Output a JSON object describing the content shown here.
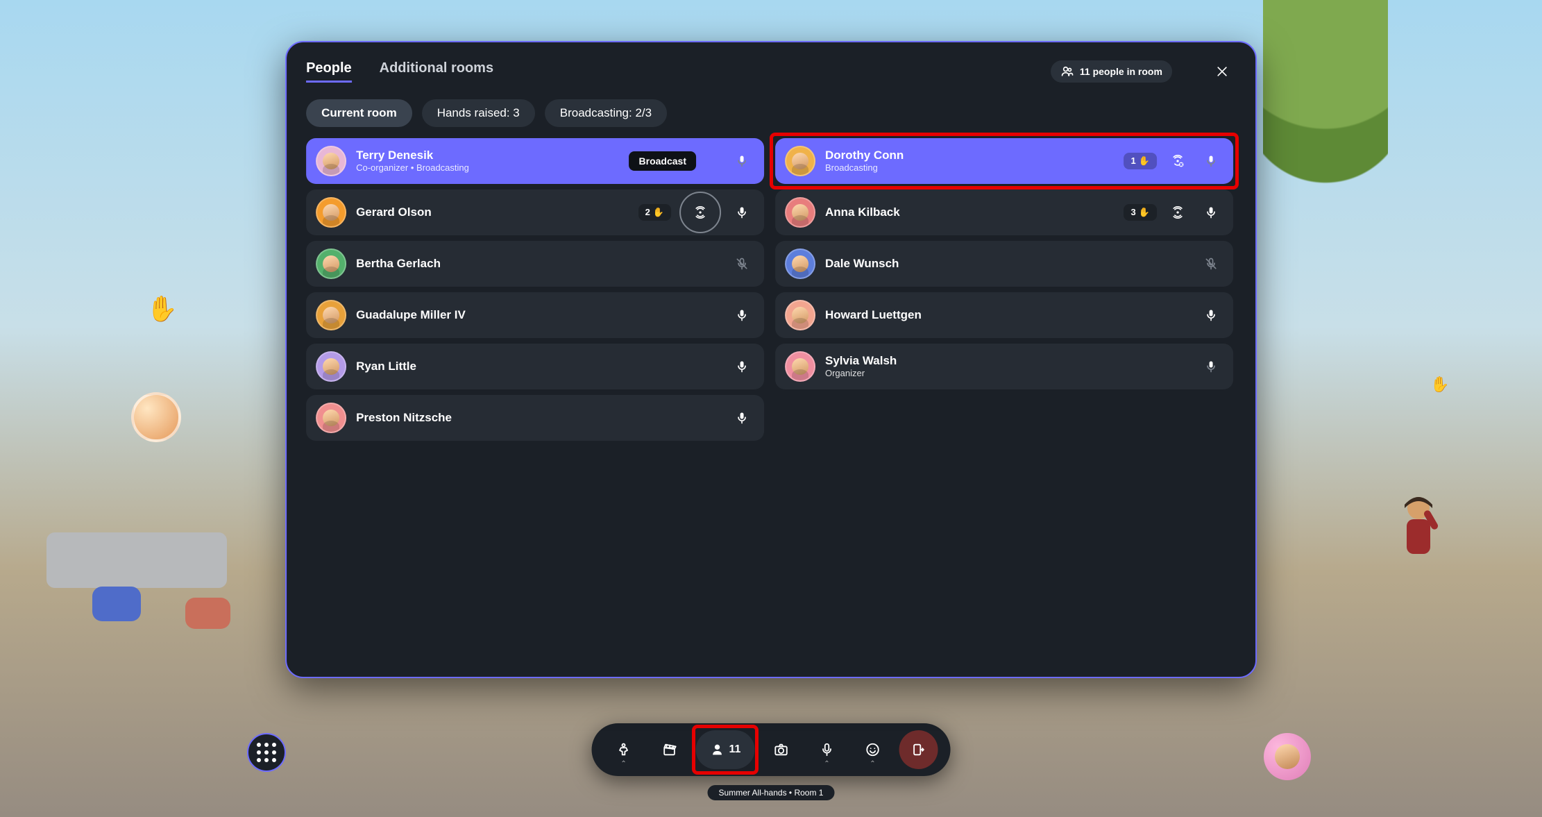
{
  "header": {
    "tabs": [
      {
        "id": "people",
        "label": "People",
        "active": true
      },
      {
        "id": "rooms",
        "label": "Additional rooms",
        "active": false
      }
    ],
    "people_count_text": "11 people in room"
  },
  "filters": [
    {
      "id": "current-room",
      "label": "Current room",
      "active": true
    },
    {
      "id": "hands-raised",
      "label": "Hands raised: 3",
      "active": false
    },
    {
      "id": "broadcasting",
      "label": "Broadcasting: 2/3",
      "active": false
    }
  ],
  "broadcast_tooltip": "Broadcast",
  "people": [
    {
      "name": "Terry Denesik",
      "sub": "Co-organizer • Broadcasting",
      "active": true,
      "hand": null,
      "broadcast": null,
      "mic": "on-dim",
      "avatar": "#e8b7d6",
      "has_tooltip": true
    },
    {
      "name": "Dorothy Conn",
      "sub": "Broadcasting",
      "active": true,
      "hand": "1",
      "broadcast": "disabled",
      "mic": "on-dim",
      "avatar": "#f0b24a",
      "highlight": true
    },
    {
      "name": "Gerard Olson",
      "sub": null,
      "active": false,
      "hand": "2",
      "broadcast": "outlined",
      "mic": "on",
      "avatar": "#f49c2d"
    },
    {
      "name": "Anna Kilback",
      "sub": null,
      "active": false,
      "hand": "3",
      "broadcast": "on",
      "mic": "on",
      "avatar": "#e87d7d"
    },
    {
      "name": "Bertha Gerlach",
      "sub": null,
      "active": false,
      "hand": null,
      "broadcast": null,
      "mic": "muted",
      "avatar": "#54b06c"
    },
    {
      "name": "Dale Wunsch",
      "sub": null,
      "active": false,
      "hand": null,
      "broadcast": null,
      "mic": "muted",
      "avatar": "#5d7edc"
    },
    {
      "name": "Guadalupe Miller IV",
      "sub": null,
      "active": false,
      "hand": null,
      "broadcast": null,
      "mic": "on",
      "avatar": "#e8a13a"
    },
    {
      "name": "Howard Luettgen",
      "sub": null,
      "active": false,
      "hand": null,
      "broadcast": null,
      "mic": "on",
      "avatar": "#f2a58f"
    },
    {
      "name": "Ryan Little",
      "sub": null,
      "active": false,
      "hand": null,
      "broadcast": null,
      "mic": "on",
      "avatar": "#b49be8"
    },
    {
      "name": "Sylvia Walsh",
      "sub": "Organizer",
      "active": false,
      "hand": null,
      "broadcast": null,
      "mic": "off-dim",
      "avatar": "#f08fa0"
    },
    {
      "name": "Preston Nitzsche",
      "sub": null,
      "active": false,
      "hand": null,
      "broadcast": null,
      "mic": "on",
      "avatar": "#f08f8f"
    }
  ],
  "toolbar": {
    "people_count": "11"
  },
  "room_label": "Summer All-hands • Room 1"
}
